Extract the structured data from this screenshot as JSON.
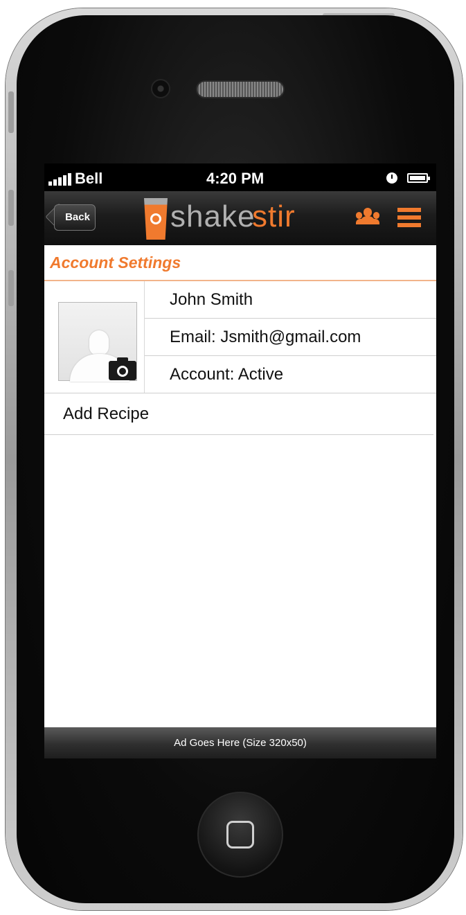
{
  "status_bar": {
    "carrier": "Bell",
    "time": "4:20 PM"
  },
  "nav": {
    "back_label": "Back",
    "logo_part1": "shake",
    "logo_part2": "stir"
  },
  "section": {
    "title": "Account Settings"
  },
  "profile": {
    "name": "John Smith",
    "email": "Email: Jsmith@gmail.com",
    "account": "Account: Active"
  },
  "actions": {
    "add_recipe": "Add Recipe"
  },
  "ad": {
    "label": "Ad Goes Here (Size 320x50)"
  },
  "colors": {
    "accent": "#f07a2e",
    "nav_bg": "#1c1c1c",
    "status_bg": "#000000"
  },
  "icons": [
    "signal-icon",
    "alarm-icon",
    "battery-icon",
    "friends-icon",
    "menu-icon",
    "camera-icon",
    "avatar-placeholder"
  ]
}
